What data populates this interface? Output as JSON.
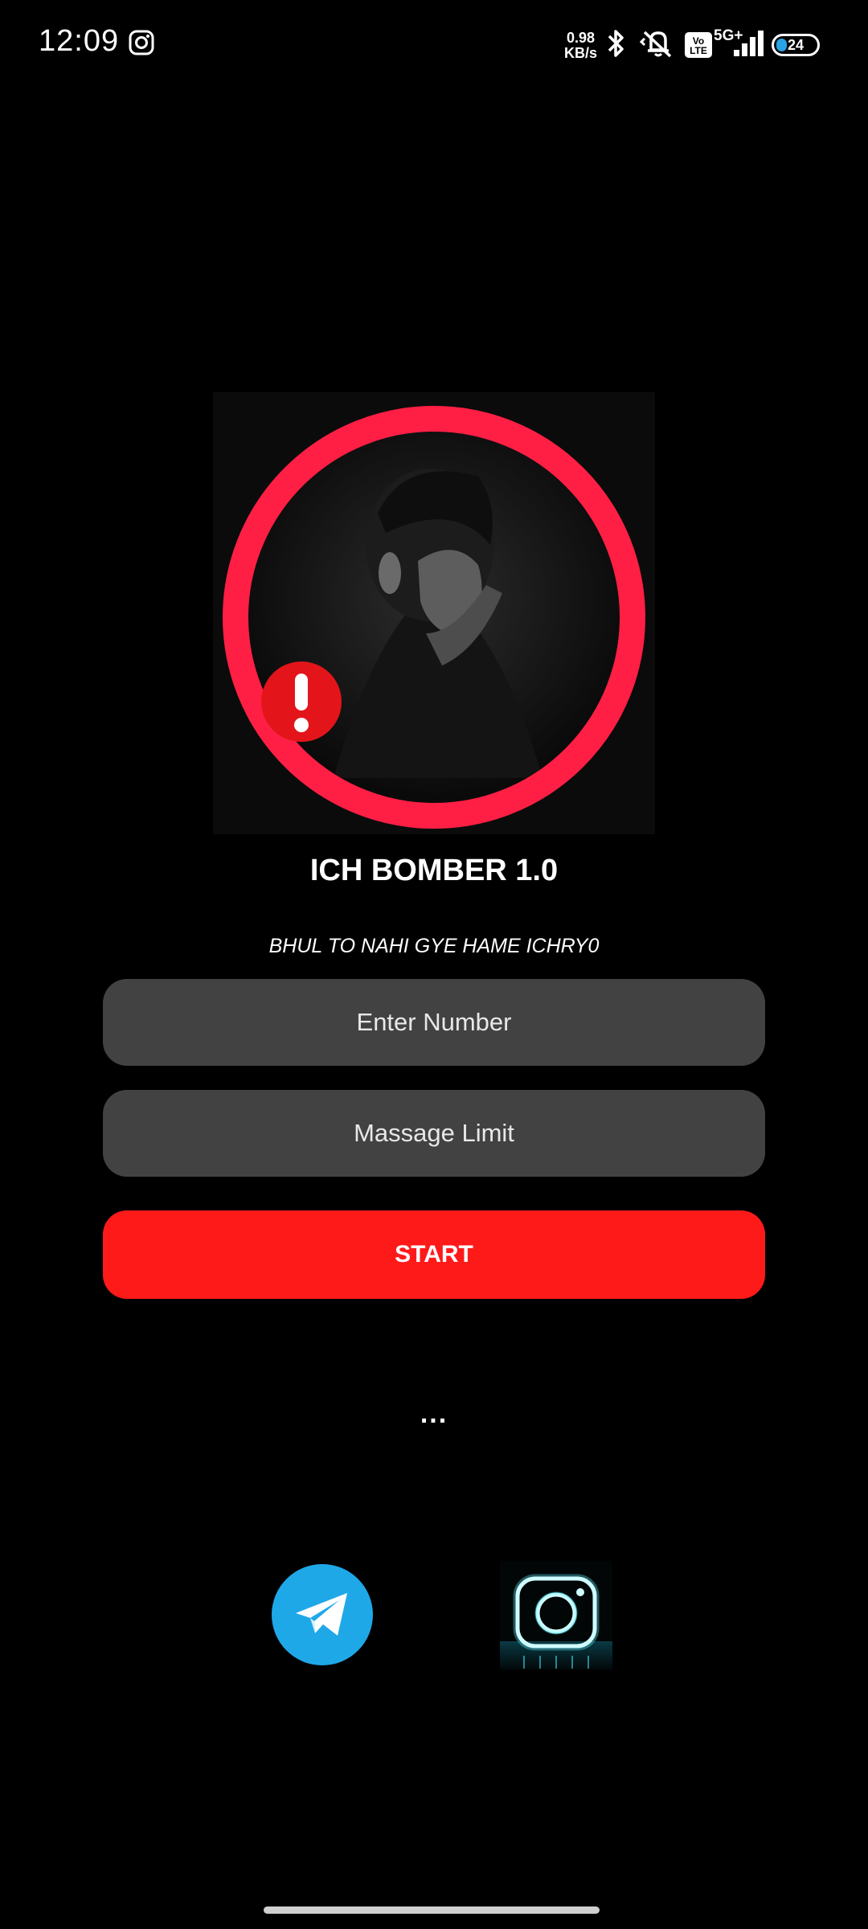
{
  "status_bar": {
    "time": "12:09",
    "net_speed_value": "0.98",
    "net_speed_unit": "KB/s",
    "volte_top": "Vo",
    "volte_bottom": "LTE",
    "network_type": "5G+",
    "battery_level": "24"
  },
  "app": {
    "title": "ICH BOMBER 1.0",
    "tagline": "BHUL TO NAHI GYE HAME ICHRY0"
  },
  "form": {
    "number_placeholder": "Enter Number",
    "limit_placeholder": "Massage Limit",
    "start_label": "START"
  },
  "loading_text": "...",
  "colors": {
    "accent_red": "#ff1a1a",
    "ring_red": "#ff1f45",
    "field_gray": "#424242",
    "telegram_blue": "#1fa8e8",
    "neon_cyan": "#5ff3ff"
  },
  "icons": {
    "status": [
      "instagram-icon",
      "bluetooth-icon",
      "vibrate-off-icon",
      "signal-icon",
      "battery-icon"
    ],
    "social": [
      "telegram-icon",
      "instagram-neon-icon"
    ]
  }
}
